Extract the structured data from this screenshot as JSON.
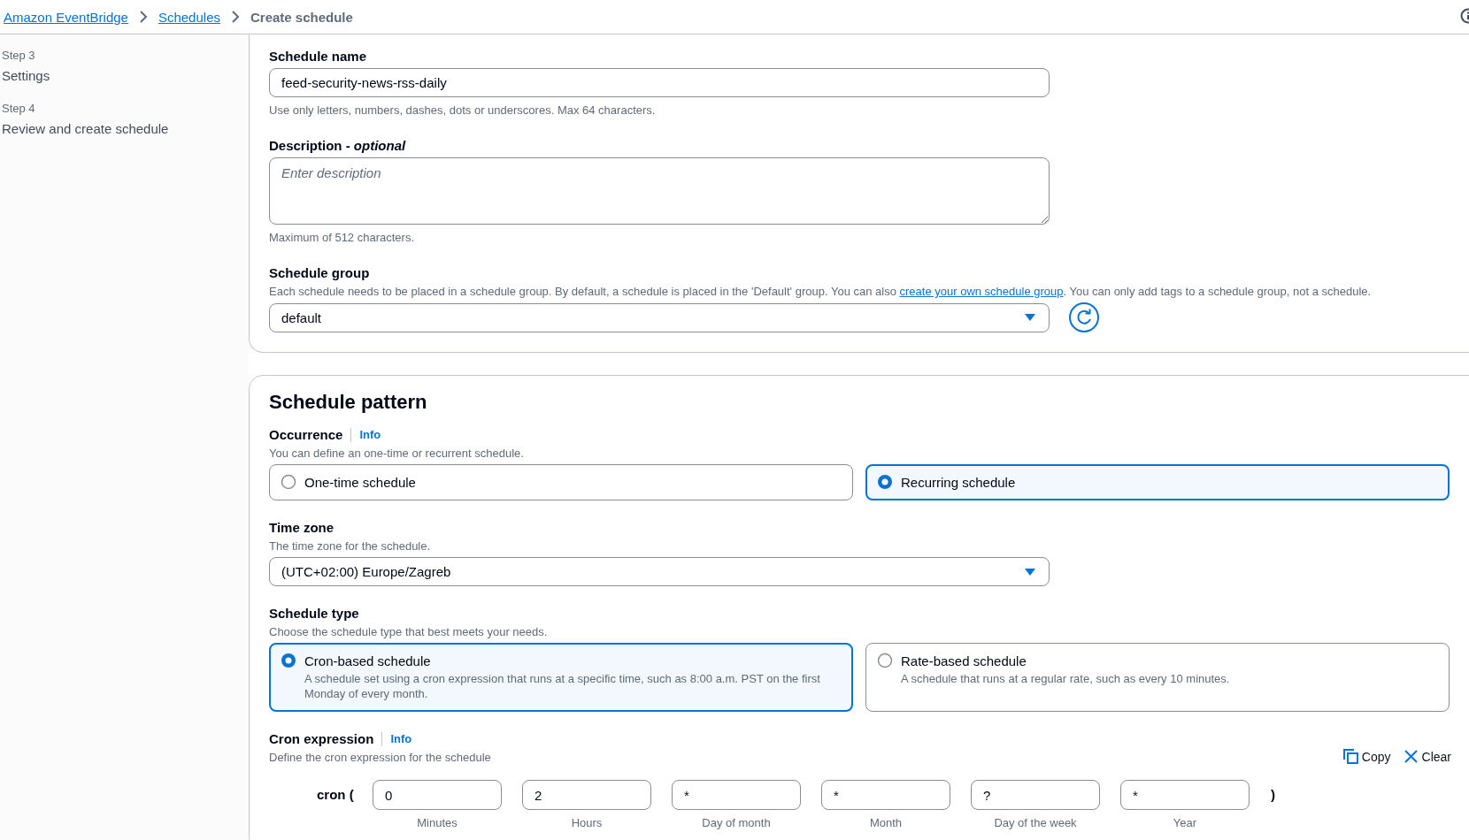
{
  "breadcrumbs": [
    {
      "label": "Amazon EventBridge",
      "kind": "link"
    },
    {
      "label": "Schedules",
      "kind": "link"
    },
    {
      "label": "Create schedule",
      "kind": "current"
    }
  ],
  "steps": [
    {
      "step": "Step 3",
      "title": "Settings"
    },
    {
      "step": "Step 4",
      "title": "Review and create schedule"
    }
  ],
  "details": {
    "name": {
      "label": "Schedule name",
      "value": "feed-security-news-rss-daily",
      "hint": "Use only letters, numbers, dashes, dots or underscores. Max 64 characters."
    },
    "description": {
      "label": "Description - *optional*",
      "placeholder": "Enter description",
      "hint": "Maximum of 512 characters."
    },
    "group": {
      "label": "Schedule group",
      "description": "Each schedule needs to be placed in a schedule group. By default, a schedule is placed in the 'Default' group. You can also ",
      "link": "create your own schedule group",
      "description_end": ". You can only add tags to a schedule group, not a schedule.",
      "value": "default"
    }
  },
  "pattern": {
    "title": "Schedule pattern",
    "occurrence": {
      "label": "Occurrence",
      "info": "Info",
      "description": "You can define an one-time or recurrent schedule.",
      "options": [
        {
          "label": "One-time schedule",
          "selected": false
        },
        {
          "label": "Recurring schedule",
          "selected": true
        }
      ]
    },
    "time_zone": {
      "label": "Time zone",
      "description": "The time zone for the schedule.",
      "value": "(UTC+02:00) Europe/Zagreb"
    },
    "schedule_type": {
      "label": "Schedule type",
      "description": "Choose the schedule type that best meets your needs.",
      "options": [
        {
          "label": "Cron-based schedule",
          "description": "A schedule set using a cron expression that runs at a specific time, such as 8:00 a.m. PST on the first Monday of every month.",
          "selected": true
        },
        {
          "label": "Rate-based schedule",
          "description": "A schedule that runs at a regular rate, such as every 10 minutes.",
          "selected": false
        }
      ]
    },
    "cron": {
      "label": "Cron expression",
      "info": "Info",
      "description": "Define the cron expression for the schedule",
      "actions": [
        {
          "label": "Copy",
          "kind": "copy"
        },
        {
          "label": "Clear",
          "kind": "clear"
        }
      ],
      "prefix": "cron (",
      "suffix": ")",
      "fields": [
        {
          "value": "0",
          "label": "Minutes"
        },
        {
          "value": "2",
          "label": "Hours"
        },
        {
          "value": "*",
          "label": "Day of month"
        },
        {
          "value": "*",
          "label": "Month"
        },
        {
          "value": "?",
          "label": "Day of the week"
        },
        {
          "value": "*",
          "label": "Year"
        }
      ]
    }
  }
}
